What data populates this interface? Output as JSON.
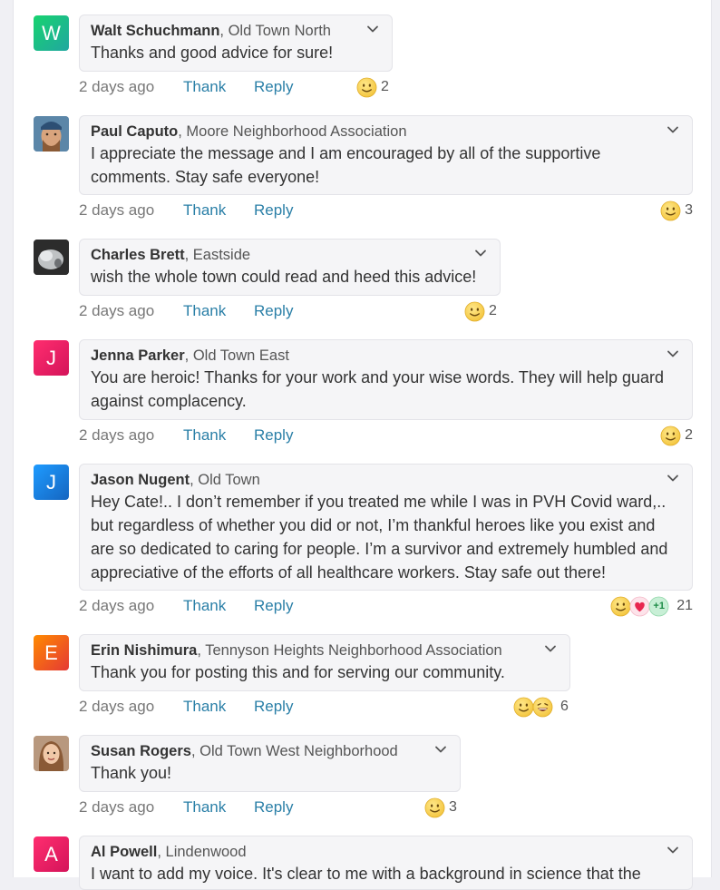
{
  "colors": {
    "link": "#2a7fa7",
    "avatar_w": "#1ec37b",
    "avatar_j_pink": "#e91e63",
    "avatar_j_blue": "#1e88e5",
    "avatar_e": "#f4511e",
    "avatar_a": "#e91e63"
  },
  "comments": [
    {
      "name": "Walt Schuchmann",
      "neighborhood": ", Old Town North",
      "initial": "W",
      "text": "Thanks and good advice for sure!",
      "time": "2 days ago",
      "thank": "Thank",
      "reply": "Reply",
      "reaction_count": "2",
      "reactions": [
        "smile-emoji"
      ]
    },
    {
      "name": "Paul Caputo",
      "neighborhood": ", Moore Neighborhood Association",
      "initial": "",
      "text": "I appreciate the message and I am encouraged by all of the supportive comments. Stay safe everyone!",
      "time": "2 days ago",
      "thank": "Thank",
      "reply": "Reply",
      "reaction_count": "3",
      "reactions": [
        "smile-emoji"
      ]
    },
    {
      "name": "Charles Brett",
      "neighborhood": ", Eastside",
      "initial": "",
      "text": "wish the whole town could read and heed this advice!",
      "time": "2 days ago",
      "thank": "Thank",
      "reply": "Reply",
      "reaction_count": "2",
      "reactions": [
        "smile-emoji"
      ]
    },
    {
      "name": "Jenna Parker",
      "neighborhood": ", Old Town East",
      "initial": "J",
      "text": "You are heroic! Thanks for your work and your wise words. They will help guard against complacency.",
      "time": "2 days ago",
      "thank": "Thank",
      "reply": "Reply",
      "reaction_count": "2",
      "reactions": [
        "smile-emoji"
      ]
    },
    {
      "name": "Jason Nugent",
      "neighborhood": ", Old Town",
      "initial": "J",
      "text": "Hey Cate!.. I don’t remember if you treated me while I was in PVH Covid ward,.. but regardless of whether you did or not, I’m thankful heroes like you exist and are so dedicated to caring for people. I’m a survivor and extremely humbled and appreciative of the efforts of all healthcare workers. Stay safe out there!",
      "time": "2 days ago",
      "thank": "Thank",
      "reply": "Reply",
      "reaction_count": "21",
      "plus_one": "+1",
      "reactions": [
        "smile-emoji",
        "heart-emoji",
        "plus-one-emoji"
      ]
    },
    {
      "name": "Erin Nishimura",
      "neighborhood": ", Tennyson Heights Neighborhood Association",
      "initial": "E",
      "text": "Thank you for posting this and for serving our community.",
      "time": "2 days ago",
      "thank": "Thank",
      "reply": "Reply",
      "reaction_count": "6",
      "reactions": [
        "smile-emoji",
        "laugh-emoji"
      ]
    },
    {
      "name": "Susan Rogers",
      "neighborhood": ", Old Town West Neighborhood",
      "initial": "",
      "text": "Thank you!",
      "time": "2 days ago",
      "thank": "Thank",
      "reply": "Reply",
      "reaction_count": "3",
      "reactions": [
        "smile-emoji"
      ]
    },
    {
      "name": "Al Powell",
      "neighborhood": ", Lindenwood",
      "initial": "A",
      "text": "I want to add my voice. It's clear to me with a background in science that the",
      "time": "",
      "thank": "",
      "reply": "",
      "reaction_count": "",
      "reactions": []
    }
  ]
}
